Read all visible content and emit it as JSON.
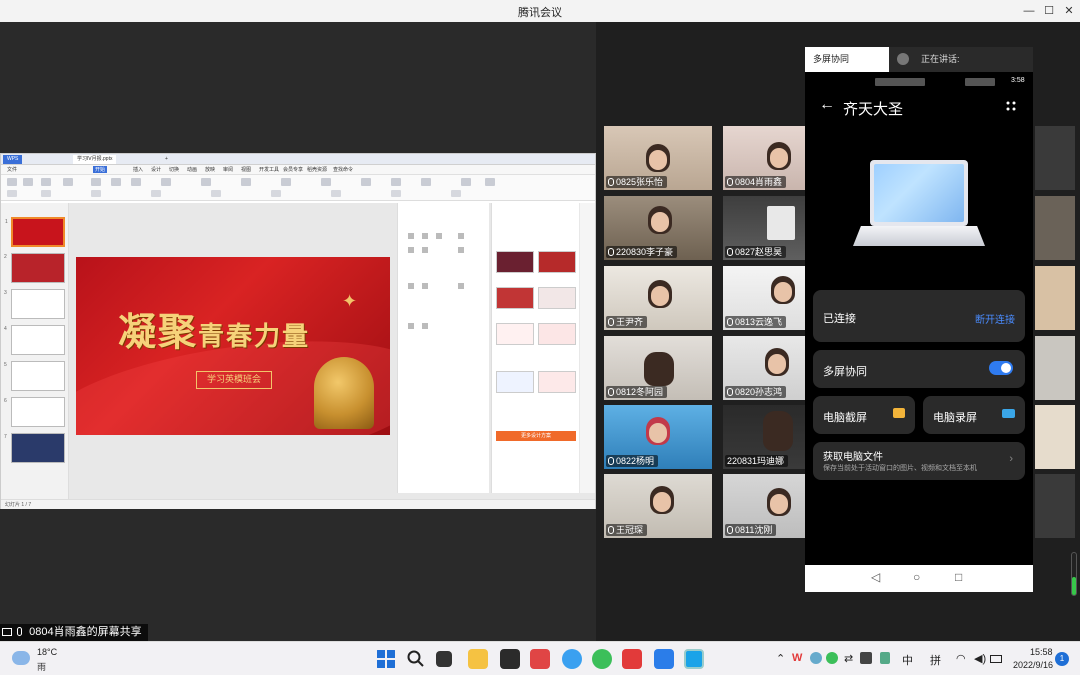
{
  "window": {
    "title": "腾讯会议",
    "minimize": "—",
    "maximize": "☐",
    "close": "✕"
  },
  "ppt": {
    "tabs": [
      "WPS",
      "学习Ⅳ月报.pptx",
      "+"
    ],
    "menu": [
      "文件",
      "开始",
      "插入",
      "设计",
      "切换",
      "动画",
      "放映",
      "审阅",
      "视图",
      "开发工具",
      "会员专享",
      "稻壳资源",
      "查找命令"
    ],
    "slide_title_big": "凝聚",
    "slide_title_rest": "青春力量",
    "slide_subtitle": "学习英模班会",
    "thumbnail_numbers": [
      "1",
      "2",
      "3",
      "4",
      "5",
      "6",
      "7"
    ],
    "design_button": "更多设计方案",
    "status_left": "幻灯片 1 / 7"
  },
  "participants": [
    {
      "name": "0825张乐怡",
      "bg": "#c9b7a8"
    },
    {
      "name": "0804肖雨鑫",
      "bg": "#d7c9c4"
    },
    {
      "name": "220830李子豪",
      "bg": "#8f8270"
    },
    {
      "name": "0827赵思昊",
      "bg": "#5b5a5a"
    },
    {
      "name": "王尹齐",
      "bg": "#e2ddd6"
    },
    {
      "name": "0813云逸飞",
      "bg": "#f1f1f1"
    },
    {
      "name": "0812冬阿园",
      "bg": "#dcd7d2"
    },
    {
      "name": "0820孙志鸿",
      "bg": "#e0e0e0"
    },
    {
      "name": "0822杨明",
      "bg": "#58a7d8"
    },
    {
      "name": "220831玛迪娜",
      "bg": "#2b2b2b"
    },
    {
      "name": "王冠琛",
      "bg": "#d9d4cd"
    },
    {
      "name": "0811沈刚",
      "bg": "#cfcfcf"
    }
  ],
  "phone": {
    "tab_label": "多屏协同",
    "speaking_label": "正在讲话:",
    "status_time": "3:58",
    "header_title": "齐天大圣",
    "connected_label": "已连接",
    "disconnect_label": "断开连接",
    "multiscreen_label": "多屏协同",
    "screenshot_label": "电脑截屏",
    "record_label": "电脑录屏",
    "files_title": "获取电脑文件",
    "files_desc": "保存当前处于活动窗口的图片、视频和文档至本机",
    "nav_back": "◁",
    "nav_home": "○",
    "nav_recent": "□"
  },
  "share_label": "0804肖雨鑫的屏幕共享",
  "taskbar": {
    "temperature": "18°C",
    "weather": "雨",
    "ime_lang": "中",
    "ime_mode": "拼",
    "time": "15:58",
    "date": "2022/9/16",
    "notification_count": "1"
  },
  "colors": {
    "slide_red": "#c8141c",
    "gold": "#f6d27a",
    "accent_blue": "#2f7bf0"
  }
}
